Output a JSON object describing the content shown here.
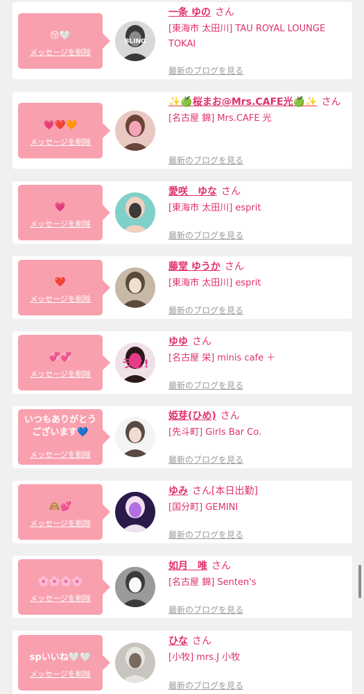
{
  "items": [
    {
      "message": "😚🤍",
      "delete_label": "メッセージを削除",
      "name": "一条 ゆの",
      "honorific": "さん",
      "tag": "",
      "shop": "[東海市 太田川] TAU ROYAL LOUNGE TOKAI",
      "blog_link": "最新のブログを見る",
      "avatar_text": "BLING",
      "avatar_colors": [
        "#d8d8d8",
        "#8a8a8a",
        "#3a3a3a"
      ]
    },
    {
      "message": "💗❤️🧡",
      "delete_label": "メッセージを削除",
      "name": "✨🍏桜まお@Mrs.CAFE光🍏✨",
      "honorific": "さん",
      "tag": "",
      "shop": "[名古屋 錦] Mrs.CAFE 光",
      "blog_link": "最新のブログを見る",
      "avatar_text": "",
      "avatar_colors": [
        "#e8c8c0",
        "#f4a6b8",
        "#6a4438"
      ]
    },
    {
      "message": "💗",
      "delete_label": "メッセージを削除",
      "name": "愛咲　ゆな",
      "honorific": "さん",
      "tag": "",
      "shop": "[東海市 太田川] esprit",
      "blog_link": "最新のブログを見る",
      "avatar_text": "",
      "avatar_colors": [
        "#7ed0c8",
        "#3a3a3a",
        "#f0d0c0"
      ]
    },
    {
      "message": "❤️",
      "delete_label": "メッセージを削除",
      "name": "藤堂 ゆうか",
      "honorific": "さん",
      "tag": "",
      "shop": "[東海市 太田川] esprit",
      "blog_link": "最新のブログを見る",
      "avatar_text": "",
      "avatar_colors": [
        "#c8b8a8",
        "#f0e0d0",
        "#5a4a3a"
      ]
    },
    {
      "message": "💞💞",
      "delete_label": "メッセージを削除",
      "name": "ゆゆ",
      "honorific": "さん",
      "tag": "",
      "shop": "[名古屋 栄] minis cafe ＋",
      "blog_link": "最新のブログを見る",
      "avatar_text": "ラじ!",
      "avatar_colors": [
        "#f0e0e8",
        "#e83a8a",
        "#2a1a1a"
      ]
    },
    {
      "message": "いつもありがとう\nございます💙",
      "delete_label": "メッセージを削除",
      "name": "姫芽(ひめ)",
      "honorific": "さん",
      "tag": "",
      "shop": "[先斗町] Girls Bar Co.",
      "blog_link": "最新のブログを見る",
      "avatar_text": "",
      "avatar_colors": [
        "#f4f4f4",
        "#f2dcd0",
        "#5a4a44"
      ]
    },
    {
      "message": "🙈💕",
      "delete_label": "メッセージを削除",
      "name": "ゆみ",
      "honorific": "さん",
      "tag": "[本日出勤]",
      "shop": "[国分町] GEMINI",
      "blog_link": "最新のブログを見る",
      "avatar_text": "",
      "avatar_colors": [
        "#2a1a4a",
        "#b070e0",
        "#f0e0f0"
      ]
    },
    {
      "message": "🌸🌸🌸🌸",
      "delete_label": "メッセージを削除",
      "name": "如月　唯",
      "honorific": "さん",
      "tag": "",
      "shop": "[名古屋 錦] Senten's",
      "blog_link": "最新のブログを見る",
      "avatar_text": "",
      "avatar_colors": [
        "#9a9a9a",
        "#fafafa",
        "#3a3a3a"
      ]
    },
    {
      "message": "spいいね🤍🤍",
      "delete_label": "メッセージを削除",
      "name": "ひな",
      "honorific": "さん",
      "tag": "",
      "shop": "[小牧] mrs.J 小牧",
      "blog_link": "最新のブログを見る",
      "avatar_text": "",
      "avatar_colors": [
        "#c8c4c0",
        "#7a6a60",
        "#e8e4e0"
      ]
    }
  ]
}
